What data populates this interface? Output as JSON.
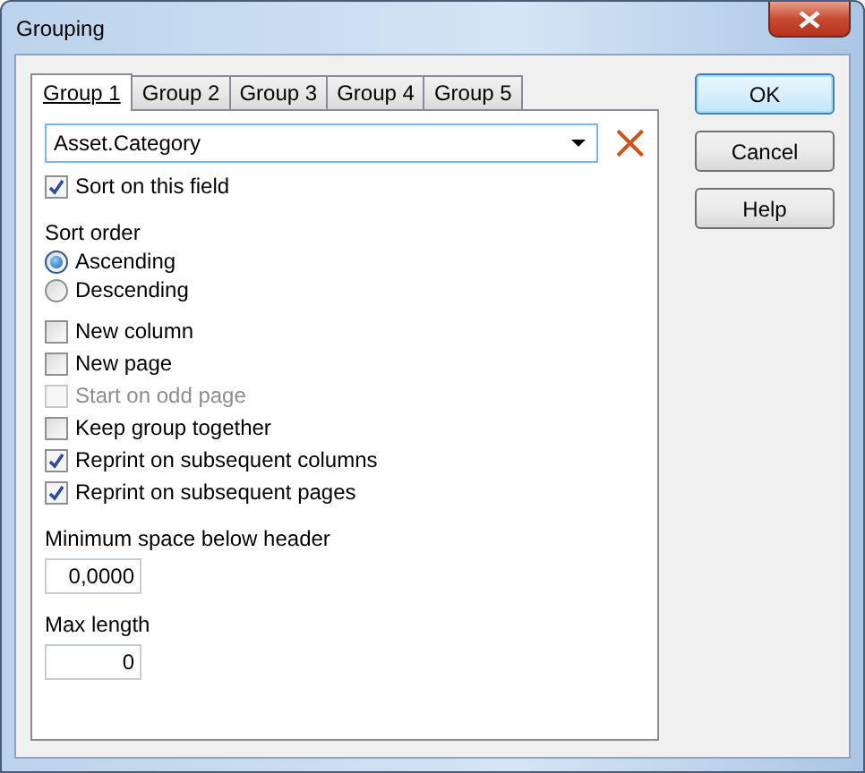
{
  "window": {
    "title": "Grouping"
  },
  "tabs": [
    {
      "label": "Group 1",
      "selected": true
    },
    {
      "label": "Group 2",
      "selected": false
    },
    {
      "label": "Group 3",
      "selected": false
    },
    {
      "label": "Group 4",
      "selected": false
    },
    {
      "label": "Group 5",
      "selected": false
    }
  ],
  "field": {
    "value": "Asset.Category"
  },
  "sort_on_field": {
    "label": "Sort on this field",
    "checked": true
  },
  "sort_order": {
    "label": "Sort order",
    "options": [
      {
        "label": "Ascending",
        "selected": true
      },
      {
        "label": "Descending",
        "selected": false
      }
    ]
  },
  "options": [
    {
      "label": "New column",
      "checked": false,
      "disabled": false
    },
    {
      "label": "New page",
      "checked": false,
      "disabled": false
    },
    {
      "label": "Start on odd page",
      "checked": false,
      "disabled": true
    },
    {
      "label": "Keep group together",
      "checked": false,
      "disabled": false
    },
    {
      "label": "Reprint on subsequent columns",
      "checked": true,
      "disabled": false
    },
    {
      "label": "Reprint on subsequent pages",
      "checked": true,
      "disabled": false
    }
  ],
  "inputs": [
    {
      "label": "Minimum space below header",
      "value": "0,0000"
    },
    {
      "label": "Max length",
      "value": "0"
    }
  ],
  "buttons": [
    {
      "label": "OK",
      "default": true
    },
    {
      "label": "Cancel",
      "default": false
    },
    {
      "label": "Help",
      "default": false
    }
  ]
}
